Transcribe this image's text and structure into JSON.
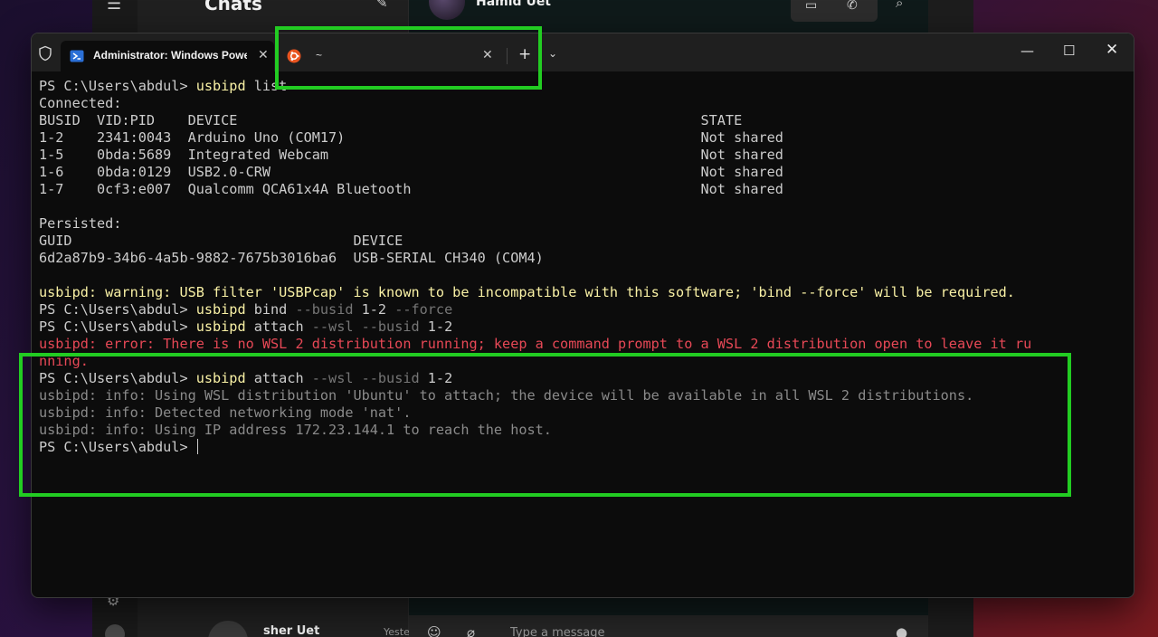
{
  "chat_app": {
    "title": "Chats",
    "contact_name": "Hamid Uet",
    "sidebar_chat": {
      "name": "sher Uet",
      "time": "Yesterday"
    },
    "message_placeholder": "Type a message"
  },
  "terminal": {
    "tabs": [
      {
        "title": "Administrator: Windows PowerShell",
        "icon": "powershell-icon",
        "active": true
      },
      {
        "title": "~",
        "icon": "ubuntu-icon",
        "active": false
      }
    ],
    "new_tab_label": "+",
    "accent_colors": {
      "command": "#f9f1a5",
      "parameter": "#767676",
      "error": "#e74856",
      "highlight_box": "#22cc22"
    },
    "lines": [
      {
        "prompt": "PS C:\\Users\\abdul> ",
        "cmd": "usbipd",
        "args": " list"
      },
      {
        "text": "Connected:"
      },
      {
        "text": "BUSID  VID:PID    DEVICE                                                        STATE"
      },
      {
        "text": "1-2    2341:0043  Arduino Uno (COM17)                                           Not shared"
      },
      {
        "text": "1-5    0bda:5689  Integrated Webcam                                             Not shared"
      },
      {
        "text": "1-6    0bda:0129  USB2.0-CRW                                                    Not shared"
      },
      {
        "text": "1-7    0cf3:e007  Qualcomm QCA61x4A Bluetooth                                   Not shared"
      },
      {
        "text": ""
      },
      {
        "text": "Persisted:"
      },
      {
        "text": "GUID                                  DEVICE"
      },
      {
        "text": "6d2a87b9-34b6-4a5b-9882-7675b3016ba6  USB-SERIAL CH340 (COM4)"
      },
      {
        "text": ""
      },
      {
        "warn": "usbipd: warning: USB filter 'USBPcap' is known to be incompatible with this software; 'bind --force' will be required."
      },
      {
        "prompt": "PS C:\\Users\\abdul> ",
        "cmd": "usbipd",
        "args": " bind",
        "param1": " --busid",
        "val1": " 1-2",
        "param2": " --force"
      },
      {
        "prompt": "PS C:\\Users\\abdul> ",
        "cmd": "usbipd",
        "args": " attach",
        "param1": " --wsl --busid",
        "val1": " 1-2"
      },
      {
        "error": "usbipd: error: There is no WSL 2 distribution running; keep a command prompt to a WSL 2 distribution open to leave it ru"
      },
      {
        "error": "nning."
      },
      {
        "prompt": "PS C:\\Users\\abdul> ",
        "cmd": "usbipd",
        "args": " attach",
        "param1": " --wsl --busid",
        "val1": " 1-2"
      },
      {
        "info": "usbipd: info: Using WSL distribution 'Ubuntu' to attach; the device will be available in all WSL 2 distributions."
      },
      {
        "info": "usbipd: info: Detected networking mode 'nat'."
      },
      {
        "info": "usbipd: info: Using IP address 172.23.144.1 to reach the host."
      },
      {
        "prompt": "PS C:\\Users\\abdul> ",
        "cursor": true
      }
    ]
  }
}
